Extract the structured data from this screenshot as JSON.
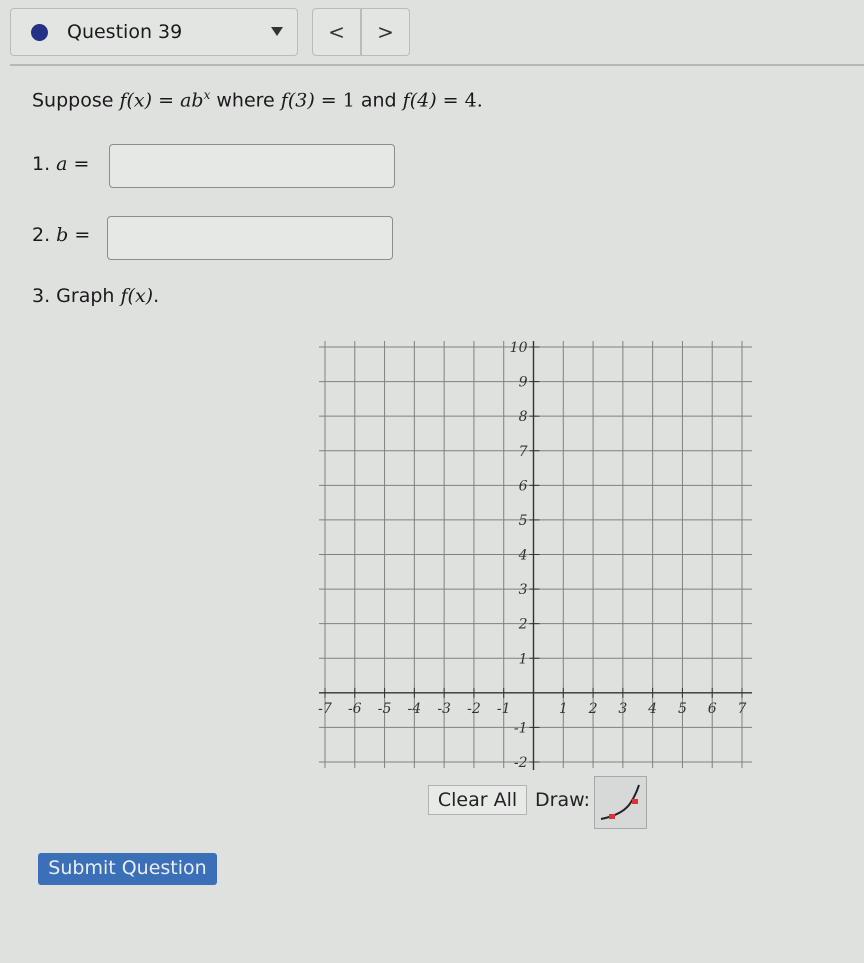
{
  "header": {
    "question_label": "Question 39",
    "status_color": "#233187",
    "prev_label": "<",
    "next_label": ">"
  },
  "question": {
    "prefix": "Suppose ",
    "f_of_x": "f(x)",
    "eq1": " = ",
    "ab": "ab",
    "exp": "x",
    "where": " where ",
    "f3": "f(3)",
    "eq2": " = 1",
    "and": " and ",
    "f4": "f(4)",
    "eq3": " = 4."
  },
  "parts": [
    {
      "number": "1. ",
      "var": "a",
      "eq": " =",
      "value": ""
    },
    {
      "number": "2. ",
      "var": "b",
      "eq": " =",
      "value": ""
    },
    {
      "number": "3. Graph ",
      "var": "f(x)",
      "eq": "."
    }
  ],
  "graph": {
    "x_range": [
      -7,
      7
    ],
    "y_range": [
      -2,
      10
    ],
    "x_ticks": [
      "-7",
      "-6",
      "-5",
      "-4",
      "-3",
      "-2",
      "-1",
      "1",
      "2",
      "3",
      "4",
      "5",
      "6",
      "7"
    ],
    "y_ticks": [
      "-2",
      "-1",
      "1",
      "2",
      "3",
      "4",
      "5",
      "6",
      "7",
      "8",
      "9",
      "10"
    ]
  },
  "controls": {
    "clear_label": "Clear All",
    "draw_label": "Draw:",
    "draw_tool": "exponential-curve-icon",
    "submit_label": "Submit Question",
    "submit_color": "#3b6fb8"
  }
}
